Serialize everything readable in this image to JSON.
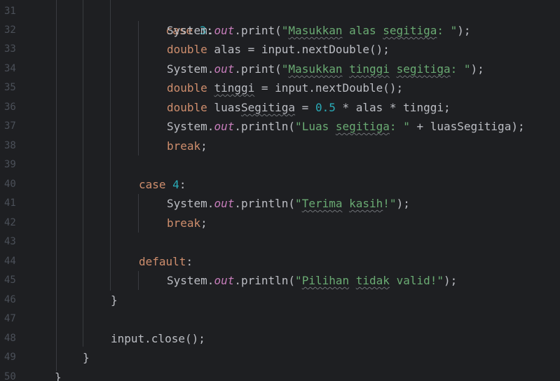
{
  "editor": {
    "line_numbers": [
      "31",
      "32",
      "33",
      "34",
      "35",
      "36",
      "37",
      "38",
      "39",
      "40",
      "41",
      "42",
      "43",
      "44",
      "45",
      "46",
      "47",
      "48",
      "49",
      "50"
    ],
    "lines": {
      "l31": {
        "kw": "case",
        "num": "3",
        "tail": ":"
      },
      "l32": {
        "a": "System.",
        "fld": "out",
        "b": ".print(",
        "str_q": "\"",
        "str_w1": "Masukkan",
        "str_sp1": " alas ",
        "str_w2": "segitiga",
        "str_end": ": \"",
        "c": ");"
      },
      "l33": {
        "kw": "double",
        "rest": " alas = input.nextDouble();"
      },
      "l34": {
        "a": "System.",
        "fld": "out",
        "b": ".print(",
        "str_q": "\"",
        "str_w1": "Masukkan",
        "str_sp1": " ",
        "str_w2": "tinggi",
        "str_sp2": " ",
        "str_w3": "segitiga",
        "str_end": ": \"",
        "c": ");"
      },
      "l35": {
        "kw": "double",
        "sp": " ",
        "var": "tinggi",
        "rest": " = input.nextDouble();"
      },
      "l36": {
        "kw": "double",
        "sp": " luas",
        "var": "Segitiga",
        "eq": " = ",
        "num": "0.5",
        "rest": " * alas * tinggi;"
      },
      "l37": {
        "a": "System.",
        "fld": "out",
        "b": ".println(",
        "str_q": "\"",
        "str_w1": "Luas",
        "str_sp1": " ",
        "str_w2": "segitiga",
        "str_end": ": \"",
        "c": " + luasSegitiga);"
      },
      "l38": {
        "kw": "break",
        "tail": ";"
      },
      "l40": {
        "kw": "case",
        "num": "4",
        "tail": ":"
      },
      "l41": {
        "a": "System.",
        "fld": "out",
        "b": ".println(",
        "str_q": "\"",
        "str_w1": "Terima",
        "str_sp1": " ",
        "str_w2": "kasih",
        "str_end": "!\"",
        "c": ");"
      },
      "l42": {
        "kw": "break",
        "tail": ";"
      },
      "l44": {
        "kw": "default",
        "tail": ":"
      },
      "l45": {
        "a": "System.",
        "fld": "out",
        "b": ".println(",
        "str_q": "\"",
        "str_w1": "Pilihan",
        "str_sp1": " ",
        "str_w2": "tidak",
        "str_end": " valid!\"",
        "c": ");"
      },
      "l46": {
        "text": "}"
      },
      "l48": {
        "text": "input.close();"
      },
      "l49": {
        "text": "}"
      },
      "l50": {
        "text": "}"
      }
    }
  }
}
